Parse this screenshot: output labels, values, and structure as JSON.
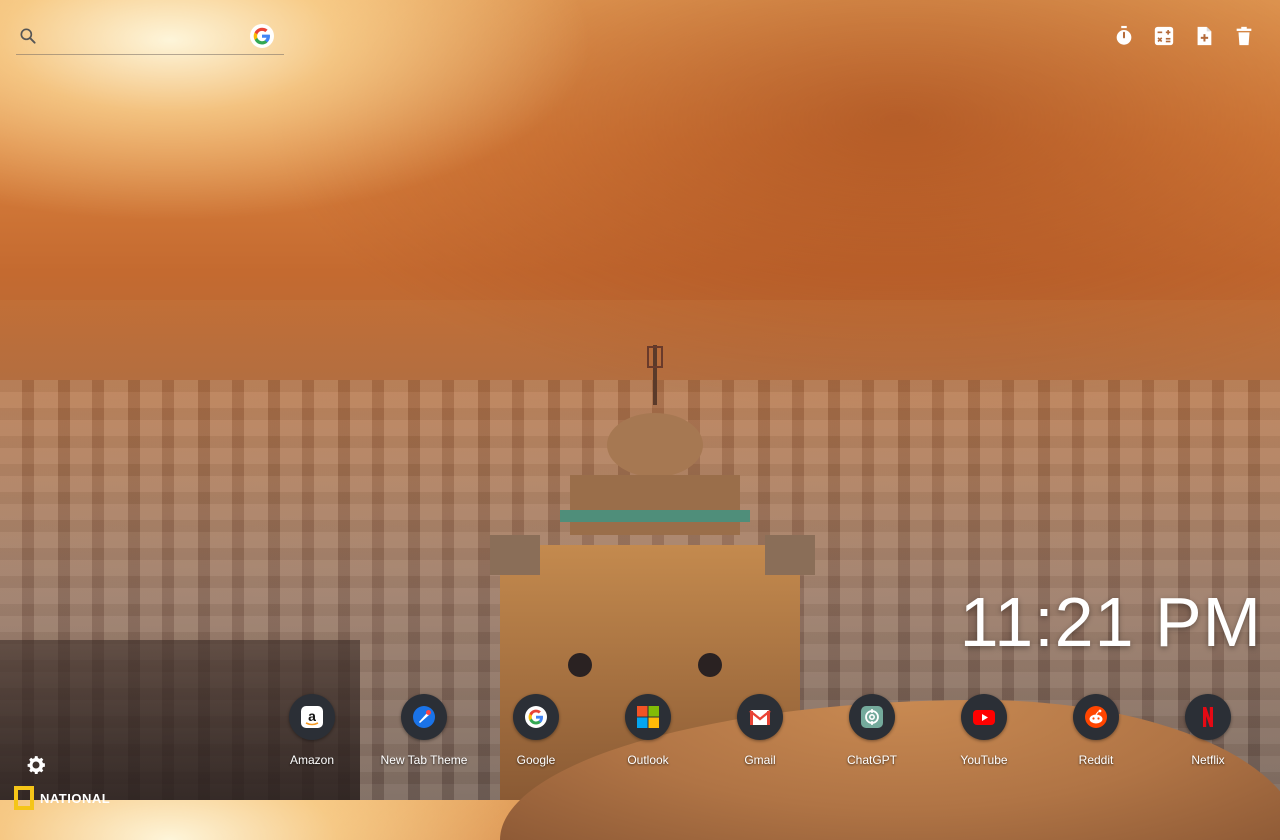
{
  "search": {
    "placeholder": "",
    "value": ""
  },
  "toolbar": {
    "items": [
      {
        "name": "timer",
        "icon": "timer-icon"
      },
      {
        "name": "calculator",
        "icon": "calculator-icon"
      },
      {
        "name": "add-note",
        "icon": "note-add-icon"
      },
      {
        "name": "delete",
        "icon": "trash-icon"
      }
    ]
  },
  "clock": {
    "time": "11:21 PM"
  },
  "shortcuts": [
    {
      "label": "Amazon",
      "icon": "amazon-icon"
    },
    {
      "label": "New Tab Theme",
      "icon": "new-tab-theme-icon"
    },
    {
      "label": "Google",
      "icon": "google-icon"
    },
    {
      "label": "Outlook",
      "icon": "outlook-icon"
    },
    {
      "label": "Gmail",
      "icon": "gmail-icon"
    },
    {
      "label": "ChatGPT",
      "icon": "chatgpt-icon"
    },
    {
      "label": "YouTube",
      "icon": "youtube-icon"
    },
    {
      "label": "Reddit",
      "icon": "reddit-icon"
    },
    {
      "label": "Netflix",
      "icon": "netflix-icon"
    }
  ],
  "footer": {
    "logo_text": "NATIONAL"
  },
  "colors": {
    "shortcut_bg": "#2b2f36",
    "natgeo_yellow": "#f5c518"
  }
}
